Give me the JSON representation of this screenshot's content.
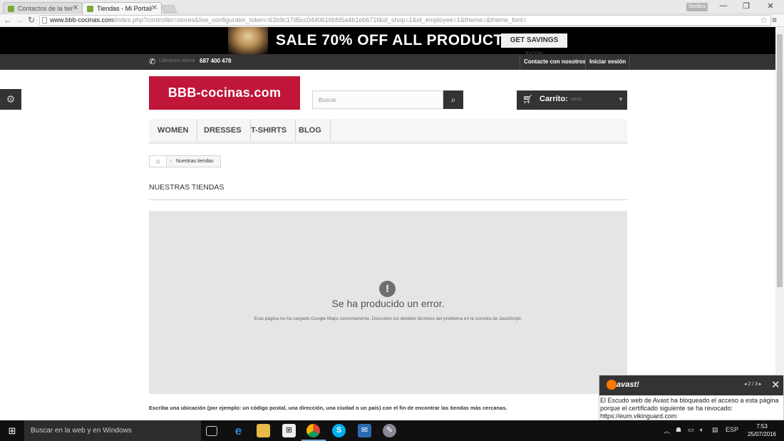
{
  "browser": {
    "tabs": [
      {
        "title": "Contactos de la tien"
      },
      {
        "title": "Tiendas - Mi Portal/c"
      }
    ],
    "window_user": "Sonlbra",
    "url_domain": "www.bbb-cocinas.com",
    "url_path": "/index.php?controller=stores&live_configurator_token=63b9c17d5cc0440616bfd5a4b1eb671f&id_shop=1&id_employee=1&theme=&theme_font="
  },
  "banner": {
    "text": "SALE 70% OFF ALL PRODUCTS",
    "button": "GET SAVINGS NOW"
  },
  "topbar": {
    "call_label": "Llámanos ahora",
    "phone": "687 400 478",
    "contact": "Contacte con nosotros",
    "login": "Iniciar sesión"
  },
  "header": {
    "logo": "BBB-cocinas.com",
    "search_placeholder": "Buscar",
    "cart_label": "Carrito:",
    "cart_status": "vacío"
  },
  "menu": [
    "WOMEN",
    "DRESSES",
    "T-SHIRTS",
    "BLOG"
  ],
  "breadcrumb": {
    "current": "Nuestras tiendas"
  },
  "page_title": "NUESTRAS TIENDAS",
  "map_error": {
    "title": "Se ha producido un error.",
    "description": "Esta página no ha cargado Google Maps correctamente. Descubre los detalles técnicos del problema en la consola de JavaScript."
  },
  "instructions": "Escriba una ubicación (por ejemplo: un código postal, una dirección, una ciudad o un país) con el fin de encontrar las tiendas más cercanas.",
  "avast": {
    "brand": "avast!",
    "pager": "2 / 3",
    "message": "El Escudo web de Avast ha bloqueado el acceso a esta página porque el certificado siguiente se ha revocado: https://eum.vikinguard.com"
  },
  "taskbar": {
    "search_placeholder": "Buscar en la web y en Windows",
    "language": "ESP",
    "time": "7:53",
    "date": "25/07/2016"
  },
  "colors": {
    "brand_red": "#c0163a",
    "dark_bar": "#333333",
    "avast_orange": "#ff7800"
  }
}
